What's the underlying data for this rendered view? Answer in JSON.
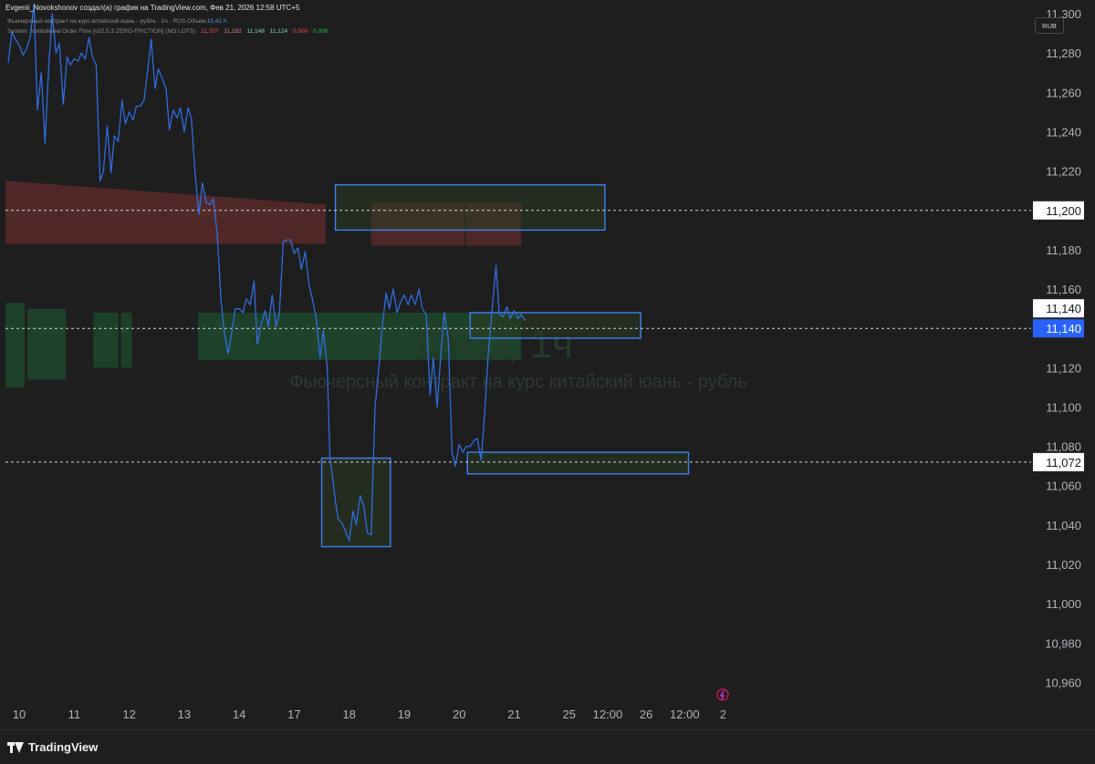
{
  "header": {
    "title": "Evgenii_Novokshonov создал(а) график на TradingView.com, Фев 21, 2026 12:58 UTC+5",
    "legend_line1": "Фьючерсный контракт на курс китайский юань - рубль · 1ч · RUS  Объём",
    "volume_value": "15,42 K",
    "legend_line2": "System: Institutional Order Flow [v22.5.3 ZERO-FRICTION] (NO LOTS)",
    "indicator_values": [
      "11,207",
      "11,182",
      "11,148",
      "11,124",
      "0,000",
      "0,000"
    ],
    "scale_button": "RUB"
  },
  "watermark": {
    "symbol": "CR1!, 1ч",
    "description": "Фьючерсный контракт на курс китайский юань - рубль"
  },
  "footer": {
    "brand": "TradingView"
  },
  "colors": {
    "background": "#1e1e1e",
    "price_line": "#2f6ee0",
    "resistance_zone": "#5a2a2a",
    "support_zone": "#1e4a2c",
    "box_border": "#3b82f6",
    "box_fill": "#2a3b22",
    "current_price_label": "#2962ff",
    "indicator_red": "#f05252",
    "indicator_red2": "#e87c7c",
    "indicator_teal": "#7fd6cf",
    "indicator_green": "#22c55e"
  },
  "chart_data": {
    "type": "line",
    "y_axis": {
      "ticks": [
        11300,
        11280,
        11260,
        11240,
        11220,
        11200,
        11180,
        11160,
        11140,
        11120,
        11100,
        11080,
        11060,
        11040,
        11020,
        11000,
        10980,
        10960
      ],
      "tick_labels": [
        "11,300",
        "11,280",
        "11,260",
        "11,240",
        "11,220",
        "11,200",
        "11,180",
        "11,160",
        "11,140",
        "11,120",
        "11,100",
        "11,080",
        "11,060",
        "11,040",
        "11,020",
        "11,000",
        "10,980",
        "10,960"
      ],
      "ylim": [
        10950,
        11307
      ]
    },
    "x_axis": {
      "range": [
        -0.05,
        18.6
      ],
      "ticks": [
        {
          "x": 0.2,
          "label": "10"
        },
        {
          "x": 1.2,
          "label": "11"
        },
        {
          "x": 2.2,
          "label": "12"
        },
        {
          "x": 3.2,
          "label": "13"
        },
        {
          "x": 4.2,
          "label": "14"
        },
        {
          "x": 5.2,
          "label": "17"
        },
        {
          "x": 6.2,
          "label": "18"
        },
        {
          "x": 7.2,
          "label": "19"
        },
        {
          "x": 8.2,
          "label": "20"
        },
        {
          "x": 9.2,
          "label": "21"
        },
        {
          "x": 10.2,
          "label": "25"
        },
        {
          "x": 10.9,
          "label": "12:00"
        },
        {
          "x": 11.6,
          "label": "26"
        },
        {
          "x": 12.3,
          "label": "12:00"
        },
        {
          "x": 13.0,
          "label": "2"
        }
      ]
    },
    "series": [
      {
        "points": [
          [
            0.0,
            11275
          ],
          [
            0.07,
            11291
          ],
          [
            0.13,
            11287
          ],
          [
            0.2,
            11284
          ],
          [
            0.27,
            11279
          ],
          [
            0.33,
            11282
          ],
          [
            0.4,
            11288
          ],
          [
            0.47,
            11305
          ],
          [
            0.53,
            11251
          ],
          [
            0.6,
            11270
          ],
          [
            0.67,
            11234
          ],
          [
            0.73,
            11270
          ],
          [
            0.8,
            11300
          ],
          [
            0.87,
            11280
          ],
          [
            0.93,
            11285
          ],
          [
            1.0,
            11254
          ],
          [
            1.07,
            11278
          ],
          [
            1.13,
            11274
          ],
          [
            1.2,
            11277
          ],
          [
            1.27,
            11276
          ],
          [
            1.33,
            11280
          ],
          [
            1.4,
            11277
          ],
          [
            1.47,
            11288
          ],
          [
            1.53,
            11278
          ],
          [
            1.6,
            11274
          ],
          [
            1.67,
            11215
          ],
          [
            1.73,
            11220
          ],
          [
            1.8,
            11243
          ],
          [
            1.87,
            11219
          ],
          [
            1.93,
            11238
          ],
          [
            2.0,
            11235
          ],
          [
            2.07,
            11256
          ],
          [
            2.13,
            11244
          ],
          [
            2.2,
            11250
          ],
          [
            2.27,
            11246
          ],
          [
            2.33,
            11253
          ],
          [
            2.4,
            11253
          ],
          [
            2.47,
            11256
          ],
          [
            2.53,
            11270
          ],
          [
            2.6,
            11287
          ],
          [
            2.67,
            11262
          ],
          [
            2.73,
            11272
          ],
          [
            2.8,
            11267
          ],
          [
            2.87,
            11262
          ],
          [
            2.93,
            11241
          ],
          [
            3.0,
            11251
          ],
          [
            3.07,
            11247
          ],
          [
            3.13,
            11252
          ],
          [
            3.2,
            11240
          ],
          [
            3.27,
            11252
          ],
          [
            3.33,
            11247
          ],
          [
            3.4,
            11218
          ],
          [
            3.47,
            11198
          ],
          [
            3.53,
            11214
          ],
          [
            3.6,
            11204
          ],
          [
            3.67,
            11203
          ],
          [
            3.73,
            11206
          ],
          [
            3.8,
            11188
          ],
          [
            3.87,
            11154
          ],
          [
            3.93,
            11138
          ],
          [
            4.0,
            11127
          ],
          [
            4.07,
            11139
          ],
          [
            4.13,
            11150
          ],
          [
            4.2,
            11150
          ],
          [
            4.27,
            11148
          ],
          [
            4.33,
            11155
          ],
          [
            4.4,
            11152
          ],
          [
            4.47,
            11164
          ],
          [
            4.53,
            11132
          ],
          [
            4.6,
            11142
          ],
          [
            4.67,
            11149
          ],
          [
            4.73,
            11141
          ],
          [
            4.8,
            11157
          ],
          [
            4.87,
            11141
          ],
          [
            4.93,
            11147
          ],
          [
            5.0,
            11184
          ],
          [
            5.07,
            11185
          ],
          [
            5.13,
            11185
          ],
          [
            5.2,
            11178
          ],
          [
            5.27,
            11181
          ],
          [
            5.33,
            11170
          ],
          [
            5.4,
            11179
          ],
          [
            5.47,
            11162
          ],
          [
            5.53,
            11155
          ],
          [
            5.6,
            11145
          ],
          [
            5.67,
            11125
          ],
          [
            5.73,
            11139
          ],
          [
            5.8,
            11120
          ],
          [
            5.85,
            11074
          ],
          [
            5.9,
            11064
          ],
          [
            5.95,
            11052
          ],
          [
            6.0,
            11043
          ],
          [
            6.07,
            11041
          ],
          [
            6.13,
            11037
          ],
          [
            6.2,
            11032
          ],
          [
            6.27,
            11047
          ],
          [
            6.33,
            11040
          ],
          [
            6.4,
            11055
          ],
          [
            6.47,
            11049
          ],
          [
            6.53,
            11036
          ],
          [
            6.6,
            11035
          ],
          [
            6.63,
            11064
          ],
          [
            6.67,
            11100
          ],
          [
            6.73,
            11117
          ],
          [
            6.8,
            11140
          ],
          [
            6.87,
            11158
          ],
          [
            6.93,
            11150
          ],
          [
            7.0,
            11160
          ],
          [
            7.07,
            11148
          ],
          [
            7.13,
            11153
          ],
          [
            7.2,
            11157
          ],
          [
            7.27,
            11152
          ],
          [
            7.33,
            11157
          ],
          [
            7.4,
            11152
          ],
          [
            7.47,
            11160
          ],
          [
            7.53,
            11150
          ],
          [
            7.6,
            11147
          ],
          [
            7.67,
            11106
          ],
          [
            7.73,
            11125
          ],
          [
            7.8,
            11100
          ],
          [
            7.87,
            11128
          ],
          [
            7.93,
            11148
          ],
          [
            8.0,
            11135
          ],
          [
            8.07,
            11077
          ],
          [
            8.13,
            11070
          ],
          [
            8.2,
            11081
          ],
          [
            8.27,
            11077
          ],
          [
            8.33,
            11080
          ],
          [
            8.4,
            11080
          ],
          [
            8.47,
            11083
          ],
          [
            8.53,
            11084
          ],
          [
            8.6,
            11073
          ],
          [
            8.67,
            11099
          ],
          [
            8.73,
            11128
          ],
          [
            8.8,
            11150
          ],
          [
            8.87,
            11172
          ],
          [
            8.93,
            11147
          ],
          [
            9.0,
            11146
          ],
          [
            9.07,
            11151
          ],
          [
            9.13,
            11145
          ],
          [
            9.2,
            11149
          ],
          [
            9.27,
            11145
          ],
          [
            9.33,
            11147
          ],
          [
            9.4,
            11144
          ]
        ]
      }
    ],
    "zones": [
      {
        "kind": "resistance",
        "x": [
          -0.05,
          5.77
        ],
        "y": [
          11183,
          11215
        ],
        "thickness_end": [
          11183,
          11203
        ]
      },
      {
        "kind": "resistance",
        "x": [
          6.6,
          8.3
        ],
        "y": [
          11182,
          11204
        ]
      },
      {
        "kind": "resistance",
        "x": [
          8.32,
          9.33
        ],
        "y": [
          11182,
          11204
        ]
      },
      {
        "kind": "support",
        "x": [
          -0.05,
          0.3
        ],
        "y": [
          11110,
          11153
        ]
      },
      {
        "kind": "support",
        "x": [
          0.35,
          1.05
        ],
        "y": [
          11114,
          11150
        ]
      },
      {
        "kind": "support",
        "x": [
          1.55,
          2.0
        ],
        "y": [
          11120,
          11148
        ]
      },
      {
        "kind": "support",
        "x": [
          2.05,
          2.25
        ],
        "y": [
          11120,
          11148
        ]
      },
      {
        "kind": "support",
        "x": [
          3.45,
          9.33
        ],
        "y": [
          11124,
          11148
        ]
      }
    ],
    "boxes": [
      {
        "x": [
          5.95,
          10.85
        ],
        "y": [
          11190,
          11213
        ]
      },
      {
        "x": [
          8.4,
          11.5
        ],
        "y": [
          11135,
          11148
        ]
      },
      {
        "x": [
          5.7,
          6.95
        ],
        "y": [
          11029,
          11074
        ]
      },
      {
        "x": [
          8.35,
          12.37
        ],
        "y": [
          11066,
          11077
        ]
      }
    ],
    "horizontal_lines": [
      {
        "y": 11200,
        "label": "11,200"
      },
      {
        "y": 11140,
        "label": "11,140"
      },
      {
        "y": 11072,
        "label": "11,072"
      }
    ],
    "current_price": {
      "y": 11140,
      "label": "11,140"
    },
    "grid": false
  }
}
